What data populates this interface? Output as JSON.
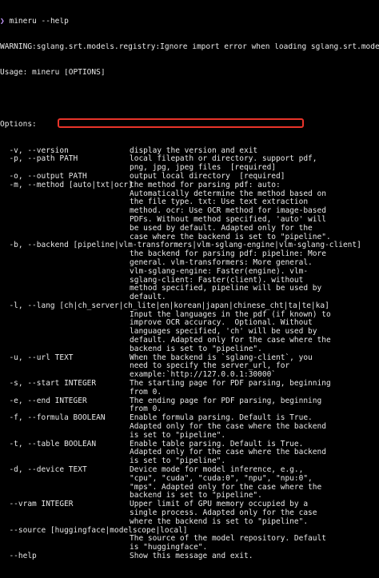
{
  "terminal": {
    "prompt_symbol": "❯",
    "command": "mineru --help",
    "warning": "WARNING:sglang.srt.models.registry:Ignore import error when loading sglang.srt.models.torch_native_l",
    "usage": "Usage: mineru [OPTIONS]",
    "blank": "",
    "options_header": "Options:",
    "rows": [
      {
        "left": "  -v, --version",
        "right": "display the version and exit"
      },
      {
        "left": "  -p, --path PATH",
        "right": "local filepath or directory. support pdf,"
      },
      {
        "left": "",
        "right": "png, jpg, jpeg files  [required]"
      },
      {
        "left": "  -o, --output PATH",
        "right": "output local directory  [required]"
      },
      {
        "left": "  -m, --method [auto|txt|ocr]",
        "right": "the method for parsing pdf: auto:"
      },
      {
        "left": "",
        "right": "Automatically determine the method based on"
      },
      {
        "left": "",
        "right": "the file type. txt: Use text extraction"
      },
      {
        "left": "",
        "right": "method. ocr: Use OCR method for image-based"
      },
      {
        "left": "",
        "right": "PDFs. Without method specified, 'auto' will"
      },
      {
        "left": "",
        "right": "be used by default. Adapted only for the"
      },
      {
        "left": "",
        "right": "case where the backend is set to \"pipeline\"."
      },
      {
        "left": "  -b, --backend [pipeline|vlm-transformers|vlm-sglang-engine|vlm-sglang-client]",
        "right": ""
      },
      {
        "left": "",
        "right": "the backend for parsing pdf: pipeline: More"
      },
      {
        "left": "",
        "right": "general. vlm-transformers: More general."
      },
      {
        "left": "",
        "right": "vlm-sglang-engine: Faster(engine). vlm-"
      },
      {
        "left": "",
        "right": "sglang-client: Faster(client). without"
      },
      {
        "left": "",
        "right": "method specified, pipeline will be used by"
      },
      {
        "left": "",
        "right": "default."
      },
      {
        "left": "  -l, --lang [ch|ch_server|ch_lite|en|korean|japan|chinese_cht|ta|te|ka]",
        "right": ""
      },
      {
        "left": "",
        "right": "Input the languages in the pdf (if known) to"
      },
      {
        "left": "",
        "right": "improve OCR accuracy.  Optional. Without"
      },
      {
        "left": "",
        "right": "languages specified, 'ch' will be used by"
      },
      {
        "left": "",
        "right": "default. Adapted only for the case where the"
      },
      {
        "left": "",
        "right": "backend is set to \"pipeline\"."
      },
      {
        "left": "  -u, --url TEXT",
        "right": "When the backend is `sglang-client`, you"
      },
      {
        "left": "",
        "right": "need to specify the server_url, for"
      },
      {
        "left": "",
        "right": "example:`http://127.0.0.1:30000`"
      },
      {
        "left": "  -s, --start INTEGER",
        "right": "The starting page for PDF parsing, beginning"
      },
      {
        "left": "",
        "right": "from 0."
      },
      {
        "left": "  -e, --end INTEGER",
        "right": "The ending page for PDF parsing, beginning"
      },
      {
        "left": "",
        "right": "from 0."
      },
      {
        "left": "  -f, --formula BOOLEAN",
        "right": "Enable formula parsing. Default is True."
      },
      {
        "left": "",
        "right": "Adapted only for the case where the backend"
      },
      {
        "left": "",
        "right": "is set to \"pipeline\"."
      },
      {
        "left": "  -t, --table BOOLEAN",
        "right": "Enable table parsing. Default is True."
      },
      {
        "left": "",
        "right": "Adapted only for the case where the backend"
      },
      {
        "left": "",
        "right": "is set to \"pipeline\"."
      },
      {
        "left": "  -d, --device TEXT",
        "right": "Device mode for model inference, e.g.,"
      },
      {
        "left": "",
        "right": "\"cpu\", \"cuda\", \"cuda:0\", \"npu\", \"npu:0\","
      },
      {
        "left": "",
        "right": "\"mps\". Adapted only for the case where the"
      },
      {
        "left": "",
        "right": "backend is set to \"pipeline\"."
      },
      {
        "left": "  --vram INTEGER",
        "right": "Upper limit of GPU memory occupied by a"
      },
      {
        "left": "",
        "right": "single process. Adapted only for the case"
      },
      {
        "left": "",
        "right": "where the backend is set to \"pipeline\"."
      },
      {
        "left": "  --source [huggingface|modelscope|local]",
        "right": ""
      },
      {
        "left": "",
        "right": "The source of the model repository. Default"
      },
      {
        "left": "",
        "right": "is \"huggingface\"."
      },
      {
        "left": "  --help",
        "right": "Show this message and exit."
      }
    ]
  },
  "colors": {
    "background": "#000000",
    "text": "#e8e8e8",
    "prompt": "#c79bff",
    "highlight_border": "#e8342a"
  }
}
